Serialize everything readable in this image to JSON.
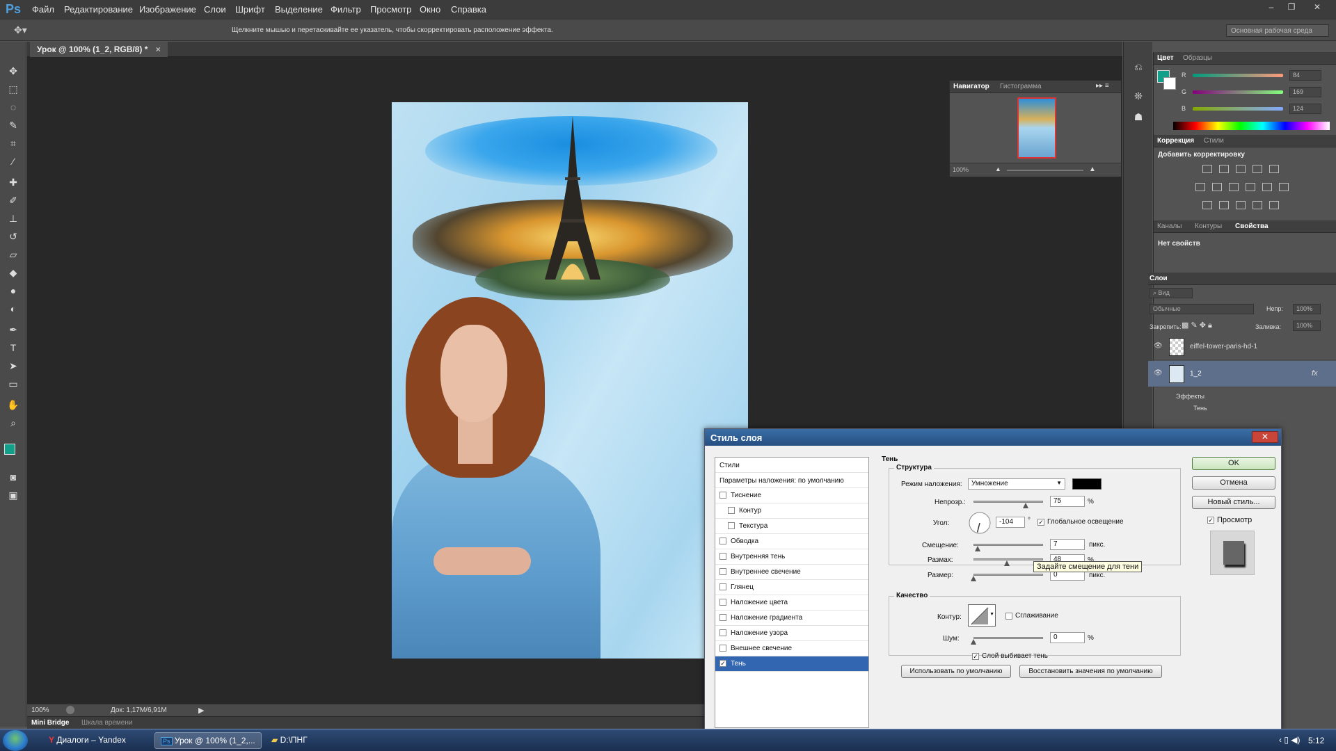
{
  "app": {
    "logo": "Ps",
    "menu": [
      "Файл",
      "Редактирование",
      "Изображение",
      "Слои",
      "Шрифт",
      "Выделение",
      "Фильтр",
      "Просмотр",
      "Окно",
      "Справка"
    ],
    "window_controls": [
      "–",
      "❐",
      "✕"
    ]
  },
  "options_bar": {
    "hint": "Щелкните мышью и перетаскивайте ее указатель, чтобы скорректировать расположение эффекта.",
    "workspace": "Основная рабочая среда"
  },
  "document": {
    "tab_title": "Урок @ 100% (1_2, RGB/8) *",
    "tab_close": "×"
  },
  "status_bar": {
    "zoom": "100%",
    "doc_info": "Док: 1,17M/6,91M"
  },
  "bottom_tabs": [
    "Mini Bridge",
    "Шкала времени"
  ],
  "navigator": {
    "tabs": [
      "Навигатор",
      "Гистограмма"
    ],
    "zoom": "100%"
  },
  "color_panel": {
    "tabs": [
      "Цвет",
      "Образцы"
    ],
    "foreground": "#13a08a",
    "channels": [
      {
        "label": "R",
        "value": "84"
      },
      {
        "label": "G",
        "value": "169"
      },
      {
        "label": "B",
        "value": "124"
      }
    ]
  },
  "adjustments": {
    "tabs": [
      "Коррекция",
      "Стили"
    ],
    "title": "Добавить корректировку"
  },
  "properties": {
    "tabs": [
      "Каналы",
      "Контуры",
      "Свойства"
    ],
    "text": "Нет свойств"
  },
  "layers": {
    "tab": "Слои",
    "filter": "Вид",
    "blend": "Обычные",
    "opacity_label": "Непр:",
    "opacity": "100%",
    "lock_label": "Закрепить:",
    "fill_label": "Заливка:",
    "fill": "100%",
    "items": [
      {
        "name": "eiffel-tower-paris-hd-1"
      },
      {
        "name": "1_2"
      }
    ],
    "effects_label": "Эффекты",
    "effect_name": "Тень",
    "fx": "fx"
  },
  "dialog": {
    "title": "Стиль слоя",
    "close": "✕",
    "list_header": "Стили",
    "list_default": "Параметры наложения: по умолчанию",
    "styles": [
      {
        "label": "Тиснение",
        "checked": false,
        "indent": false
      },
      {
        "label": "Контур",
        "checked": false,
        "indent": true
      },
      {
        "label": "Текстура",
        "checked": false,
        "indent": true
      },
      {
        "label": "Обводка",
        "checked": false,
        "indent": false
      },
      {
        "label": "Внутренняя тень",
        "checked": false,
        "indent": false
      },
      {
        "label": "Внутреннее свечение",
        "checked": false,
        "indent": false
      },
      {
        "label": "Глянец",
        "checked": false,
        "indent": false
      },
      {
        "label": "Наложение цвета",
        "checked": false,
        "indent": false
      },
      {
        "label": "Наложение градиента",
        "checked": false,
        "indent": false
      },
      {
        "label": "Наложение узора",
        "checked": false,
        "indent": false
      },
      {
        "label": "Внешнее свечение",
        "checked": false,
        "indent": false
      },
      {
        "label": "Тень",
        "checked": true,
        "indent": false
      }
    ],
    "section_title": "Тень",
    "structure_title": "Структура",
    "blend_label": "Режим наложения:",
    "blend_value": "Умножение",
    "shadow_color": "#000000",
    "opacity_label": "Непрозр.:",
    "opacity_value": "75",
    "opacity_level": 0.75,
    "angle_label": "Угол:",
    "angle_value": "-104",
    "degree": "°",
    "global_light_label": "Глобальное освещение",
    "global_light_checked": true,
    "offset_label": "Смещение:",
    "offset_value": "7",
    "offset_level": 0.06,
    "spread_label": "Размах:",
    "spread_value": "48",
    "spread_level": 0.48,
    "size_label": "Размер:",
    "size_value": "0",
    "size_level": 0,
    "unit_px": "пикс.",
    "unit_pct": "%",
    "quality_title": "Качество",
    "contour_label": "Контур:",
    "antialias_label": "Сглаживание",
    "noise_label": "Шум:",
    "noise_value": "0",
    "noise_level": 0,
    "knockout_label": "Слой выбивает тень",
    "knockout_checked": true,
    "btn_make_default": "Использовать по умолчанию",
    "btn_reset_default": "Восстановить значения по умолчанию",
    "btn_ok": "OK",
    "btn_cancel": "Отмена",
    "btn_new_style": "Новый стиль...",
    "preview_label": "Просмотр",
    "preview_checked": true,
    "tooltip": "Задайте смещение для тени"
  },
  "taskbar": {
    "items": [
      {
        "label": "Диалоги – Yandex",
        "icon": "yandex-icon"
      },
      {
        "label": "Урок @ 100% (1_2,...",
        "icon": "photoshop-icon"
      },
      {
        "label": "D:\\ПНГ",
        "icon": "folder-icon"
      }
    ],
    "clock": "5:12"
  }
}
